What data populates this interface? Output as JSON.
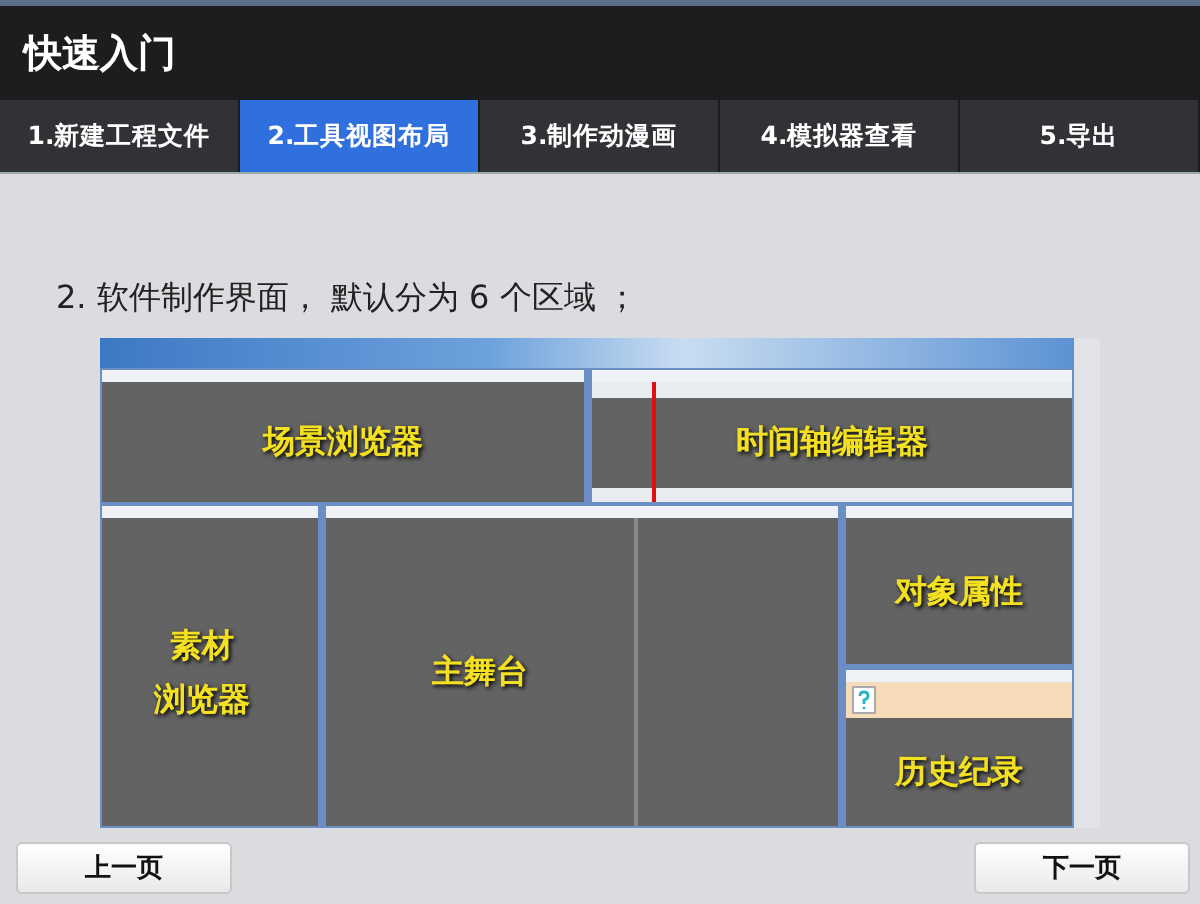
{
  "window": {
    "title": "快速入门"
  },
  "tabs": [
    {
      "label": "1.新建工程文件",
      "selected": false
    },
    {
      "label": "2.工具视图布局",
      "selected": true
    },
    {
      "label": "3.制作动漫画",
      "selected": false
    },
    {
      "label": "4.模拟器查看",
      "selected": false
    },
    {
      "label": "5.导出",
      "selected": false
    }
  ],
  "heading": "2. 软件制作界面， 默认分为 6 个区域 ；",
  "screenshot": {
    "top_panels": [
      {
        "kind": "scene",
        "label": "场景浏览器"
      },
      {
        "kind": "timeline",
        "label": "时间轴编辑器"
      }
    ],
    "bottom_panels": [
      {
        "kind": "assets",
        "label": "素材浏览器"
      },
      {
        "kind": "stage",
        "label": "主舞台"
      },
      {
        "kind": "properties",
        "label": "对象属性"
      },
      {
        "kind": "history",
        "label": "历史纪录"
      }
    ]
  },
  "buttons": [
    {
      "label": "上一页"
    },
    {
      "label": "下一页"
    }
  ]
}
